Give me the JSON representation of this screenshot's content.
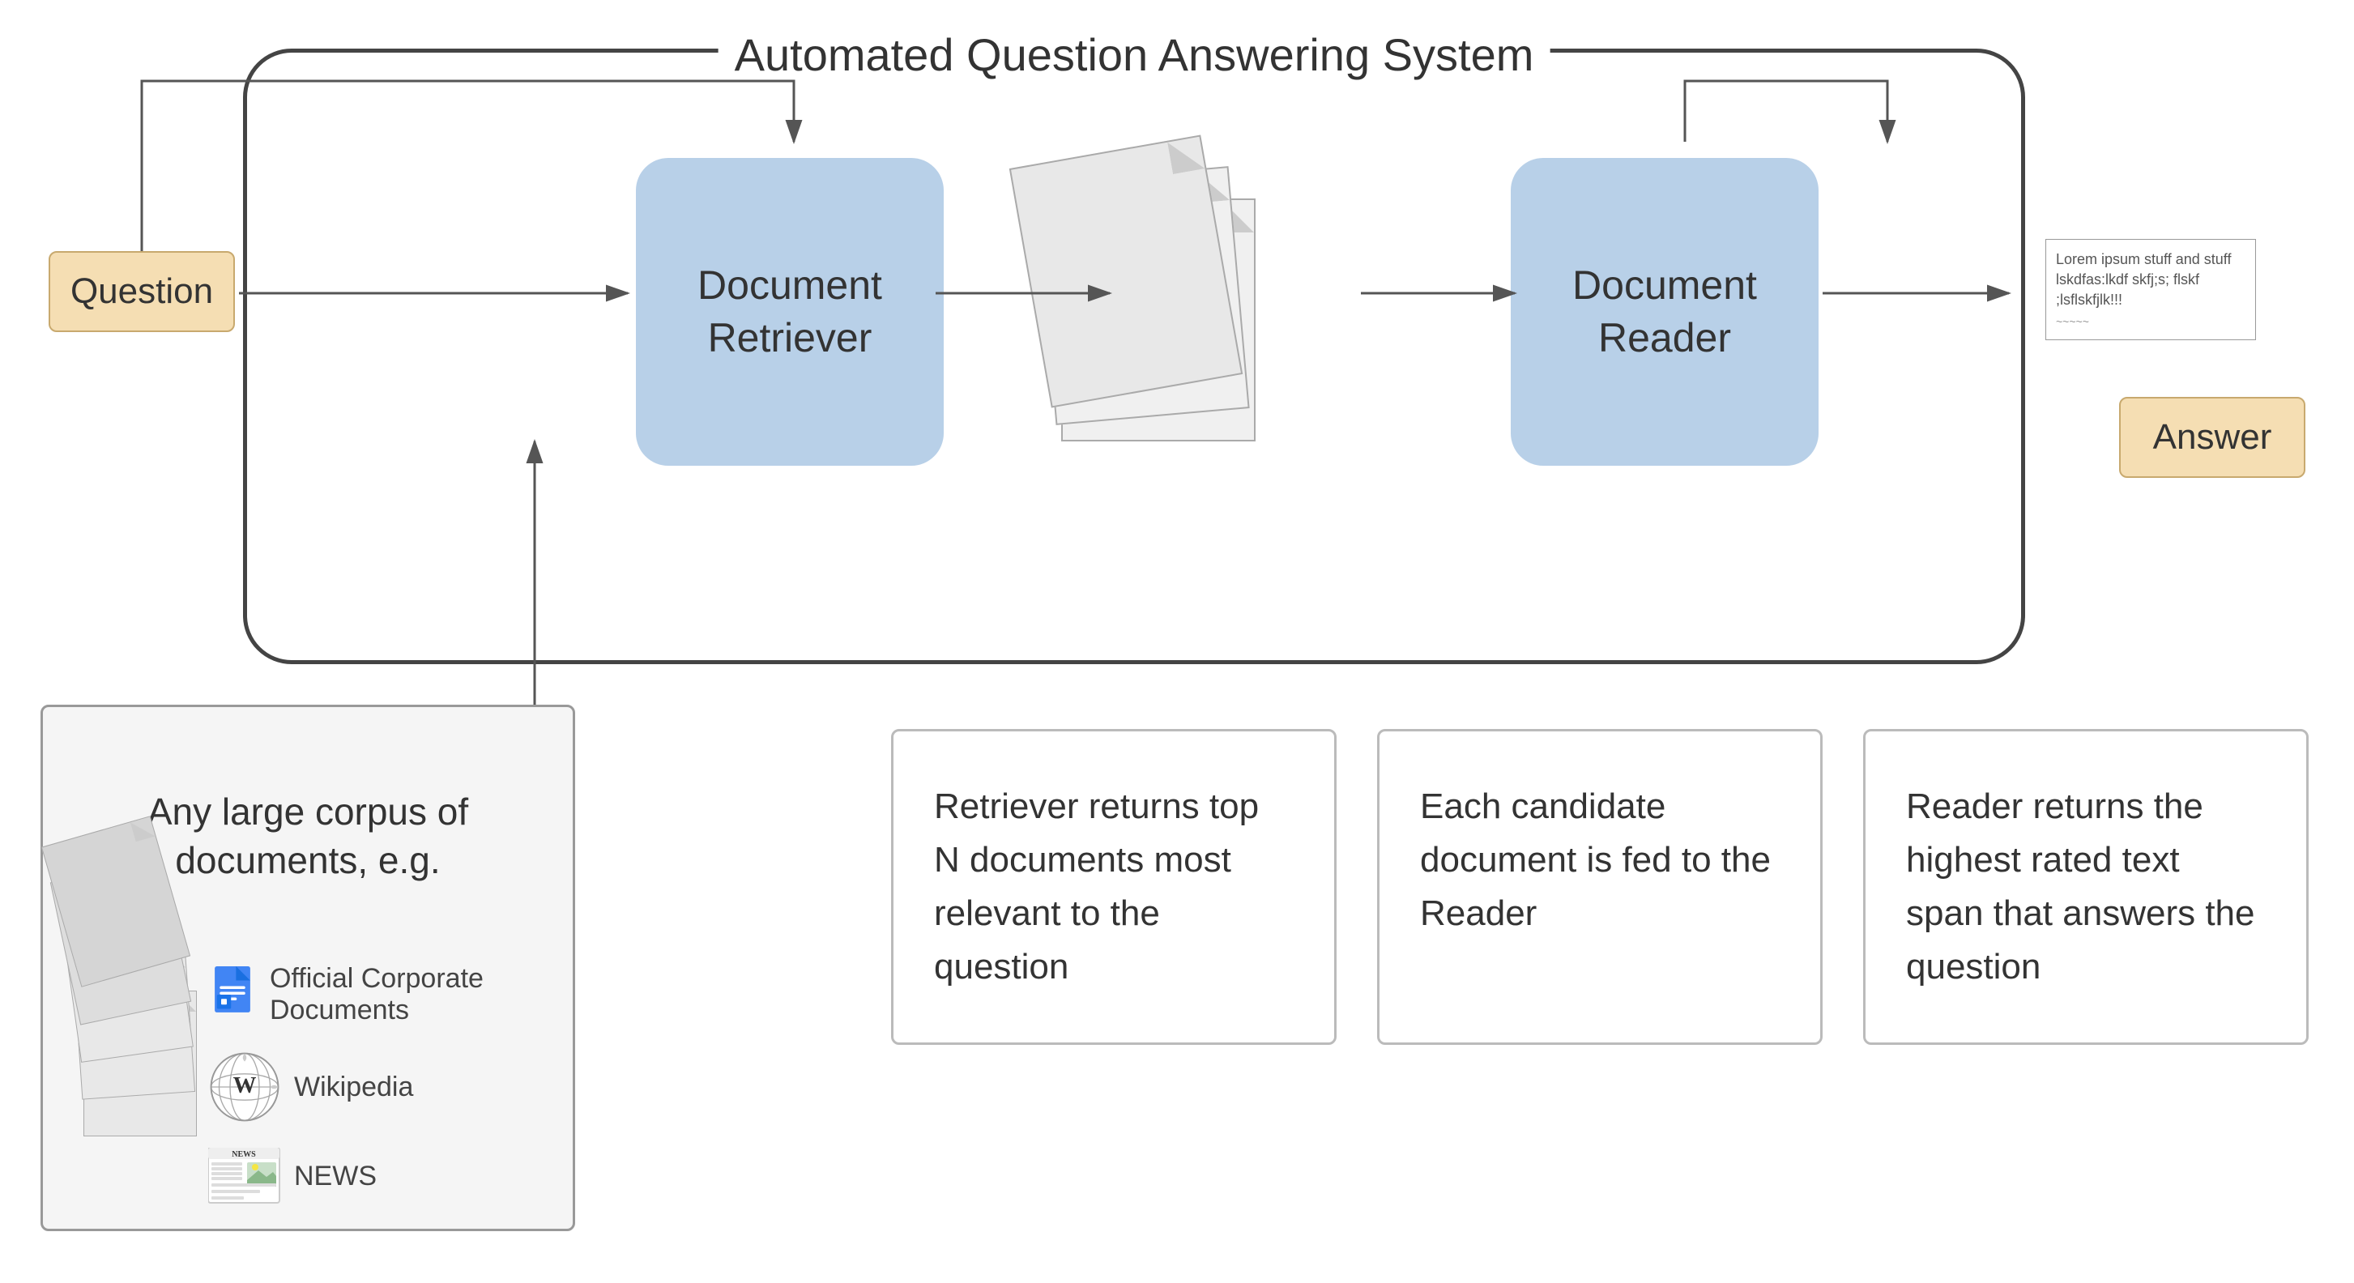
{
  "system": {
    "title": "Automated Question Answering System",
    "question_label": "Question",
    "answer_label": "Answer",
    "retriever_label": "Document\nRetriever",
    "reader_label": "Document\nReader",
    "lorem_text": "Lorem ipsum stuff and stuff lskdfas:lkdf skfj;s; flskf ;lsflskfjlk!!!"
  },
  "corpus": {
    "title": "Any large corpus of documents, e.g.",
    "items": [
      {
        "icon": "google-docs-icon",
        "label": "Official Corporate Documents"
      },
      {
        "icon": "wikipedia-icon",
        "label": "Wikipedia"
      },
      {
        "icon": "news-icon",
        "label": "NEWS"
      }
    ]
  },
  "descriptions": [
    {
      "id": "retriever-desc",
      "text": "Retriever returns top N documents most relevant to the question"
    },
    {
      "id": "candidate-desc",
      "text": "Each candidate document is fed to the Reader"
    },
    {
      "id": "reader-desc",
      "text": "Reader returns the highest rated text span that answers the question"
    }
  ]
}
